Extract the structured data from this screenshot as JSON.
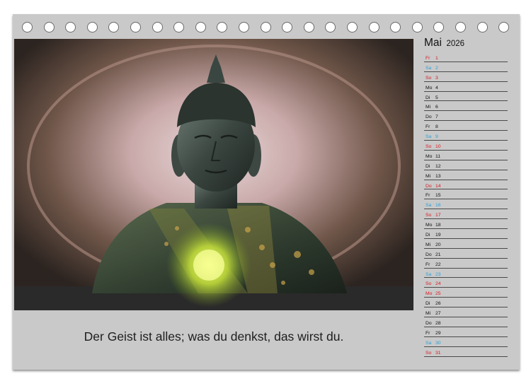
{
  "calendar": {
    "month": "Mai",
    "year": "2026",
    "caption": "Der Geist ist alles; was du denkst, das wirst du.",
    "binding_holes": 23,
    "colors": {
      "page_bg": "#c9c9c9",
      "weekday": "#111111",
      "saturday": "#2a9fd6",
      "sunday_holiday": "#d9181f"
    },
    "days": [
      {
        "wd": "Fr",
        "d": "1",
        "type": "holiday"
      },
      {
        "wd": "Sa",
        "d": "2",
        "type": "saturday"
      },
      {
        "wd": "So",
        "d": "3",
        "type": "sunday"
      },
      {
        "wd": "Mo",
        "d": "4",
        "type": "weekday"
      },
      {
        "wd": "Di",
        "d": "5",
        "type": "weekday"
      },
      {
        "wd": "Mi",
        "d": "6",
        "type": "weekday"
      },
      {
        "wd": "Do",
        "d": "7",
        "type": "weekday"
      },
      {
        "wd": "Fr",
        "d": "8",
        "type": "weekday"
      },
      {
        "wd": "Sa",
        "d": "9",
        "type": "saturday"
      },
      {
        "wd": "So",
        "d": "10",
        "type": "sunday"
      },
      {
        "wd": "Mo",
        "d": "11",
        "type": "weekday"
      },
      {
        "wd": "Di",
        "d": "12",
        "type": "weekday"
      },
      {
        "wd": "Mi",
        "d": "13",
        "type": "weekday"
      },
      {
        "wd": "Do",
        "d": "14",
        "type": "holiday"
      },
      {
        "wd": "Fr",
        "d": "15",
        "type": "weekday"
      },
      {
        "wd": "Sa",
        "d": "16",
        "type": "saturday"
      },
      {
        "wd": "So",
        "d": "17",
        "type": "sunday"
      },
      {
        "wd": "Mo",
        "d": "18",
        "type": "weekday"
      },
      {
        "wd": "Di",
        "d": "19",
        "type": "weekday"
      },
      {
        "wd": "Mi",
        "d": "20",
        "type": "weekday"
      },
      {
        "wd": "Do",
        "d": "21",
        "type": "weekday"
      },
      {
        "wd": "Fr",
        "d": "22",
        "type": "weekday"
      },
      {
        "wd": "Sa",
        "d": "23",
        "type": "saturday"
      },
      {
        "wd": "So",
        "d": "24",
        "type": "sunday"
      },
      {
        "wd": "Mo",
        "d": "25",
        "type": "holiday"
      },
      {
        "wd": "Di",
        "d": "26",
        "type": "weekday"
      },
      {
        "wd": "Mi",
        "d": "27",
        "type": "weekday"
      },
      {
        "wd": "Do",
        "d": "28",
        "type": "weekday"
      },
      {
        "wd": "Fr",
        "d": "29",
        "type": "weekday"
      },
      {
        "wd": "Sa",
        "d": "30",
        "type": "saturday"
      },
      {
        "wd": "So",
        "d": "31",
        "type": "sunday"
      }
    ]
  }
}
